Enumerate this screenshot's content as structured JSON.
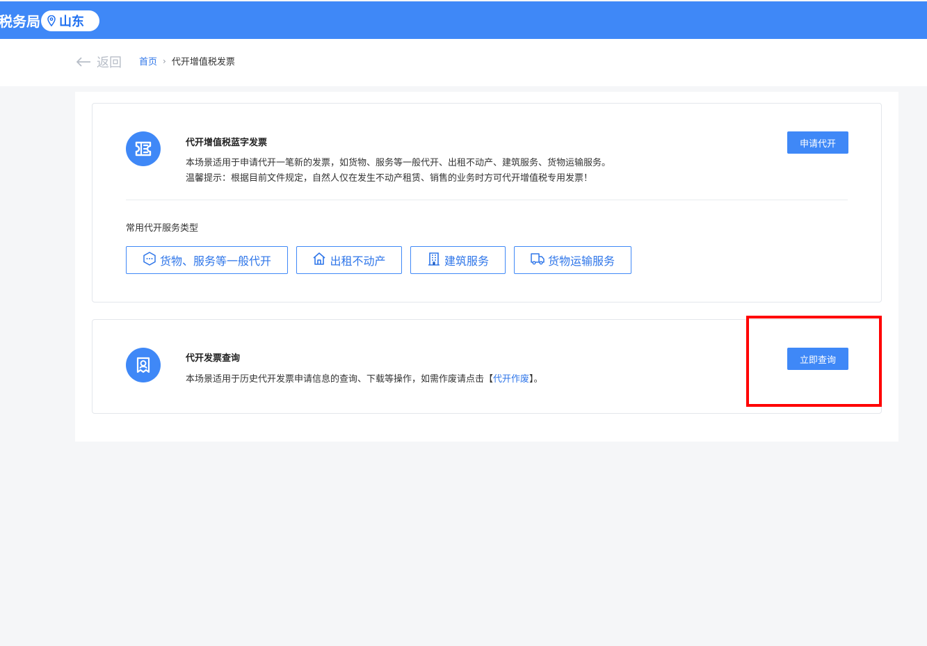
{
  "header": {
    "title": "税务局",
    "region": "山东",
    "region_icon": "map-pin-icon",
    "brand_color": "#3f88f7"
  },
  "navigation": {
    "back_label": "返回",
    "breadcrumb": {
      "home": "首页",
      "separator": "›",
      "current": "代开增值税发票"
    }
  },
  "cards": {
    "apply": {
      "icon": "invoice-ticket-icon",
      "title": "代开增值税蓝字发票",
      "description": "本场景适用于申请代开一笔新的发票，如货物、服务等一般代开、出租不动产、建筑服务、货物运输服务。",
      "tip": "温馨提示：根据目前文件规定，自然人仅在发生不动产租赁、销售的业务时方可代开增值税专用发票！",
      "button_label": "申请代开",
      "services_label": "常用代开服务类型",
      "services": [
        {
          "label": "货物、服务等一般代开",
          "icon": "goods-service-icon"
        },
        {
          "label": "出租不动产",
          "icon": "house-icon"
        },
        {
          "label": "建筑服务",
          "icon": "building-icon"
        },
        {
          "label": "货物运输服务",
          "icon": "truck-icon"
        }
      ]
    },
    "query": {
      "icon": "invoice-query-icon",
      "title": "代开发票查询",
      "description_before": "本场景适用于历史代开发票申请信息的查询、下载等操作，如需作废请点击【",
      "void_link": "代开作废",
      "description_after": "】。",
      "button_label": "立即查询"
    }
  },
  "annotation": {
    "highlight_color": "#ff0000"
  }
}
